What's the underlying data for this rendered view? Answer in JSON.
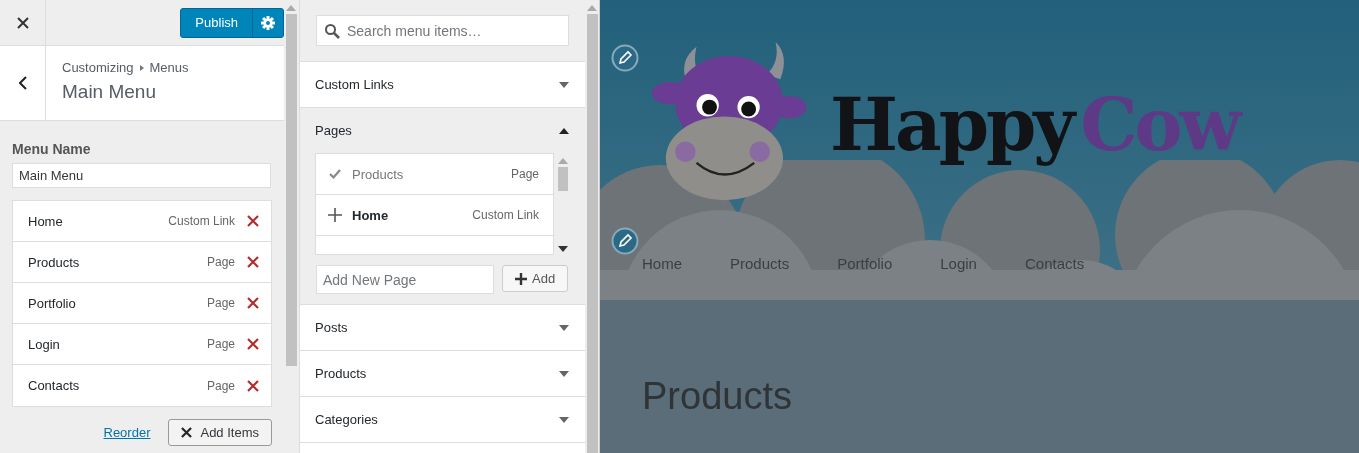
{
  "header": {
    "publish_label": "Publish"
  },
  "section": {
    "breadcrumb": [
      "Customizing",
      "Menus"
    ],
    "title": "Main Menu"
  },
  "menu_name": {
    "label": "Menu Name",
    "value": "Main Menu"
  },
  "menu_items": [
    {
      "title": "Home",
      "type": "Custom Link"
    },
    {
      "title": "Products",
      "type": "Page"
    },
    {
      "title": "Portfolio",
      "type": "Page"
    },
    {
      "title": "Login",
      "type": "Page"
    },
    {
      "title": "Contacts",
      "type": "Page"
    }
  ],
  "footer": {
    "reorder_link": "Reorder",
    "add_items_button": "Add Items"
  },
  "search": {
    "placeholder": "Search menu items…"
  },
  "item_sections": [
    {
      "title": "Custom Links",
      "expanded": false
    },
    {
      "title": "Pages",
      "expanded": true,
      "items": [
        {
          "title": "Products",
          "type": "Page",
          "added": true
        },
        {
          "title": "Home",
          "type": "Custom Link",
          "added": false
        }
      ],
      "new_page_placeholder": "Add New Page",
      "add_button": "Add"
    },
    {
      "title": "Posts",
      "expanded": false
    },
    {
      "title": "Products",
      "expanded": false
    },
    {
      "title": "Categories",
      "expanded": false
    }
  ],
  "preview": {
    "logo": [
      "Happy",
      "Cow"
    ],
    "nav": [
      "Home",
      "Products",
      "Portfolio",
      "Login",
      "Contacts"
    ],
    "page_title": "Products"
  }
}
